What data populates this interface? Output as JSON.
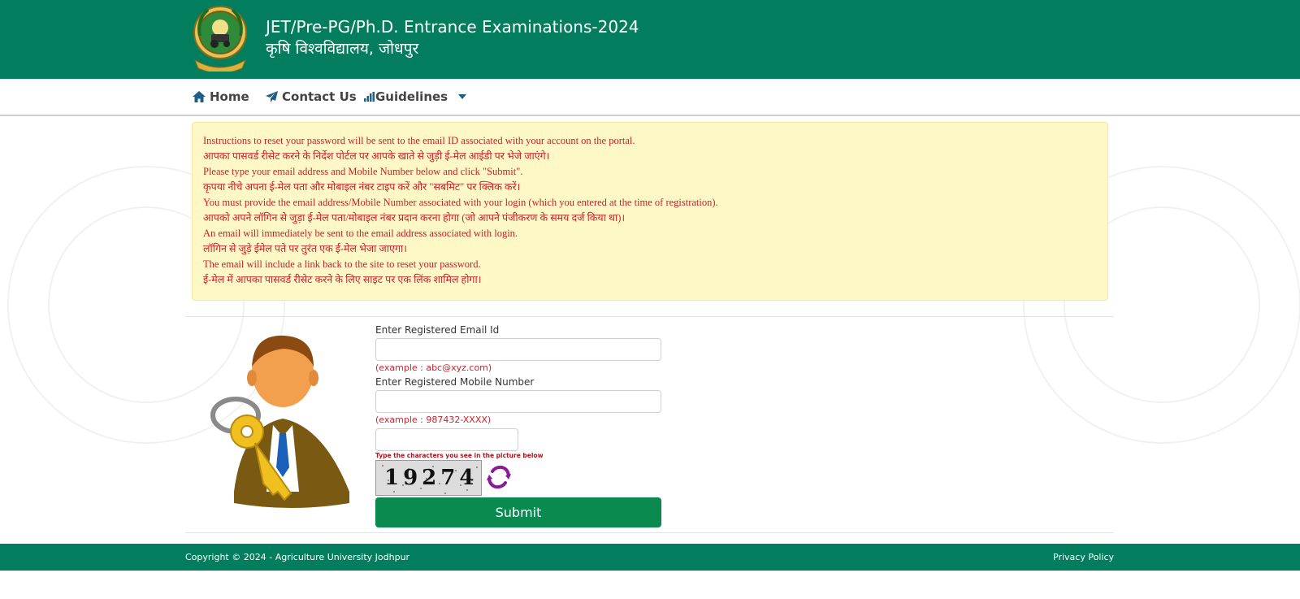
{
  "header": {
    "title_en": "JET/Pre-PG/Ph.D. Entrance Examinations-2024",
    "title_hi": "कृषि विश्वविद्यालय, जोधपुर",
    "logo_icon": "university-emblem-icon"
  },
  "nav": {
    "home": "Home",
    "contact": "Contact Us",
    "guidelines": "Guidelines"
  },
  "instructions": [
    "Instructions to reset your password will be sent to the email ID associated with your account on the portal.",
    "आपका पासवर्ड रीसेट करने के निर्देश पोर्टल पर आपके खाते से जुड़ी ई-मेल आईडी पर भेजे जाएंगे।",
    "Please type your email address and Mobile Number below and click \"Submit\".",
    "कृपया नीचे अपना ई-मेल पता और मोबाइल नंबर टाइप करें और \"सबमिट\" पर क्लिक करें।",
    "You must provide the email address/Mobile Number associated with your login (which you entered at the time of registration).",
    "आपको अपने लॉगिन से जुड़ा ई-मेल पता/मोबाइल नंबर प्रदान करना होगा (जो आपने पंजीकरण के समय दर्ज किया था)।",
    "An email will immediately be sent to the email address associated with login.",
    "लॉगिन से जुड़े ईमेल पते पर तुरंत एक ई-मेल भेजा जाएगा।",
    "The email will include a link back to the site to reset your password.",
    "ई-मेल में आपका पासवर्ड रीसेट करने के लिए साइट पर एक लिंक शामिल होगा।"
  ],
  "form": {
    "email_label": "Enter Registered Email Id",
    "email_value": "",
    "email_hint": "(example : abc@xyz.com)",
    "mobile_label": "Enter Registered Mobile Number",
    "mobile_value": "",
    "mobile_hint": "(example : 987432-XXXX)",
    "captcha_value": "",
    "captcha_label": "Type the characters you see in the picture below",
    "captcha_text": "19274",
    "submit_label": "Submit"
  },
  "footer": {
    "copyright": "Copyright © 2024 - Agriculture University Jodhpur",
    "privacy": "Privacy Policy"
  },
  "colors": {
    "brand_green": "#027e5e",
    "button_green": "#0b8a4f",
    "instruction_bg": "#fef7c6",
    "instruction_text": "#c8202e"
  }
}
